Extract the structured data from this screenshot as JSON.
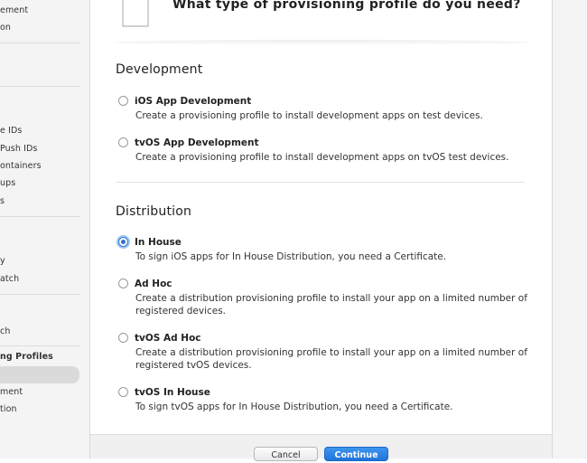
{
  "sidebar": {
    "items": [
      {
        "label": "ement"
      },
      {
        "label": "on"
      },
      {
        "label": "e IDs"
      },
      {
        "label": "Push IDs"
      },
      {
        "label": "ontainers"
      },
      {
        "label": "ups"
      },
      {
        "label": "s"
      },
      {
        "label": "y"
      },
      {
        "label": "atch"
      },
      {
        "label": "ch"
      },
      {
        "label": "ng Profiles"
      },
      {
        "label": "ment"
      },
      {
        "label": "tion"
      }
    ]
  },
  "header": {
    "title": "What type of provisioning profile do you need?"
  },
  "development": {
    "title": "Development",
    "options": [
      {
        "label": "iOS App Development",
        "desc": "Create a provisioning profile to install development apps on test devices.",
        "checked": false
      },
      {
        "label": "tvOS App Development",
        "desc": "Create a provisioning profile to install development apps on tvOS test devices.",
        "checked": false
      }
    ]
  },
  "distribution": {
    "title": "Distribution",
    "options": [
      {
        "label": "In House",
        "desc": "To sign iOS apps for In House Distribution, you need a Certificate.",
        "checked": true
      },
      {
        "label": "Ad Hoc",
        "desc": "Create a distribution provisioning profile to install your app on a limited number of registered devices.",
        "checked": false
      },
      {
        "label": "tvOS Ad Hoc",
        "desc": "Create a distribution provisioning profile to install your app on a limited number of registered tvOS devices.",
        "checked": false
      },
      {
        "label": "tvOS In House",
        "desc": "To sign tvOS apps for In House Distribution, you need a Certificate.",
        "checked": false
      }
    ]
  },
  "footer": {
    "cancel_label": "Cancel",
    "continue_label": "Continue"
  },
  "colors": {
    "accent": "#2f6fd0",
    "continue_button": "#1f74d9",
    "sidebar_bg": "#f4f4f4"
  }
}
